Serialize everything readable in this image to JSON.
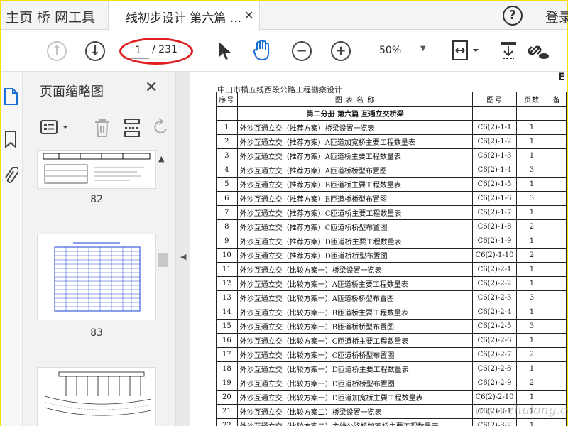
{
  "tabs": {
    "home_label": "主页  桥 网工具",
    "doc_label": "线初步设计 第六篇 ...",
    "close_symbol": "✕"
  },
  "header_right": {
    "help_symbol": "?",
    "login_label": "登录"
  },
  "toolbar": {
    "page_current": "1",
    "page_total": "/ 231",
    "zoom": "50%"
  },
  "panel": {
    "title": "页面缩略图",
    "close_symbol": "✕",
    "thumbnails": [
      {
        "page": "82"
      },
      {
        "page": "83"
      },
      {
        "page": ""
      }
    ]
  },
  "document": {
    "header": "中山市横五线西段公路工程勘察设计",
    "corner_mark": "E",
    "columns": [
      "序号",
      "图 表 名 称",
      "图号",
      "页数",
      "备"
    ],
    "section_title": "第二分册    第六篇  互通立交桥梁",
    "rows": [
      {
        "no": "1",
        "name": "外沙互通立交（推荐方案）桥梁设置一览表",
        "code": "C6(2)-1-1",
        "pages": "1"
      },
      {
        "no": "2",
        "name": "外沙互通立交（推荐方案）A匝道加宽桥主要工程数量表",
        "code": "C6(2)-1-2",
        "pages": "1"
      },
      {
        "no": "3",
        "name": "外沙互通立交（推荐方案）A匝道桥主要工程数量表",
        "code": "C6(2)-1-3",
        "pages": "1"
      },
      {
        "no": "4",
        "name": "外沙互通立交（推荐方案）A匝道桥桥型布置图",
        "code": "C6(2)-1-4",
        "pages": "3"
      },
      {
        "no": "5",
        "name": "外沙互通立交（推荐方案）B匝道桥主要工程数量表",
        "code": "C6(2)-1-5",
        "pages": "1"
      },
      {
        "no": "6",
        "name": "外沙互通立交（推荐方案）B匝道桥桥型布置图",
        "code": "C6(2)-1-6",
        "pages": "3"
      },
      {
        "no": "7",
        "name": "外沙互通立交（推荐方案）C匝道桥主要工程数量表",
        "code": "C6(2)-1-7",
        "pages": "1"
      },
      {
        "no": "8",
        "name": "外沙互通立交（推荐方案）C匝道桥桥型布置图",
        "code": "C6(2)-1-8",
        "pages": "2"
      },
      {
        "no": "9",
        "name": "外沙互通立交（推荐方案）D匝道桥主要工程数量表",
        "code": "C6(2)-1-9",
        "pages": "1"
      },
      {
        "no": "10",
        "name": "外沙互通立交（推荐方案）D匝道桥桥型布置图",
        "code": "C6(2)-1-10",
        "pages": "2"
      },
      {
        "no": "11",
        "name": "外沙互通立交（比较方案一）桥梁设置一览表",
        "code": "C6(2)-2-1",
        "pages": "1"
      },
      {
        "no": "12",
        "name": "外沙互通立交（比较方案一）A匝道桥主要工程数量表",
        "code": "C6(2)-2-2",
        "pages": "1"
      },
      {
        "no": "13",
        "name": "外沙互通立交（比较方案一）A匝道桥桥型布置图",
        "code": "C6(2)-2-3",
        "pages": "3"
      },
      {
        "no": "14",
        "name": "外沙互通立交（比较方案一）B匝道桥主要工程数量表",
        "code": "C6(2)-2-4",
        "pages": "1"
      },
      {
        "no": "15",
        "name": "外沙互通立交（比较方案一）B匝道桥桥型布置图",
        "code": "C6(2)-2-5",
        "pages": "3"
      },
      {
        "no": "16",
        "name": "外沙互通立交（比较方案一）C匝道桥主要工程数量表",
        "code": "C6(2)-2-6",
        "pages": "1"
      },
      {
        "no": "17",
        "name": "外沙互通立交（比较方案一）C匝道桥桥型布置图",
        "code": "C6(2)-2-7",
        "pages": "2"
      },
      {
        "no": "18",
        "name": "外沙互通立交（比较方案一）D匝道桥主要工程数量表",
        "code": "C6(2)-2-8",
        "pages": "1"
      },
      {
        "no": "19",
        "name": "外沙互通立交（比较方案一）D匝道桥桥型布置图",
        "code": "C6(2)-2-9",
        "pages": "2"
      },
      {
        "no": "20",
        "name": "外沙互通立交（比较方案一）D匝道加宽桥主要工程数量表",
        "code": "C6(2)-2-10",
        "pages": "1"
      },
      {
        "no": "21",
        "name": "外沙互通立交（比较方案二）桥梁设置一览表",
        "code": "C6(2)-3-1",
        "pages": "1"
      },
      {
        "no": "22",
        "name": "外沙互通立交（比较方案二）主线公路桥加宽桥主要工程数量表",
        "code": "C6(2)-3-2",
        "pages": "1"
      }
    ],
    "watermark": "www.zhulong.com"
  },
  "colors": {
    "annotation_oval": "#e02020",
    "window_border": "#f2e200",
    "accent_blue": "#1a6fd6"
  }
}
